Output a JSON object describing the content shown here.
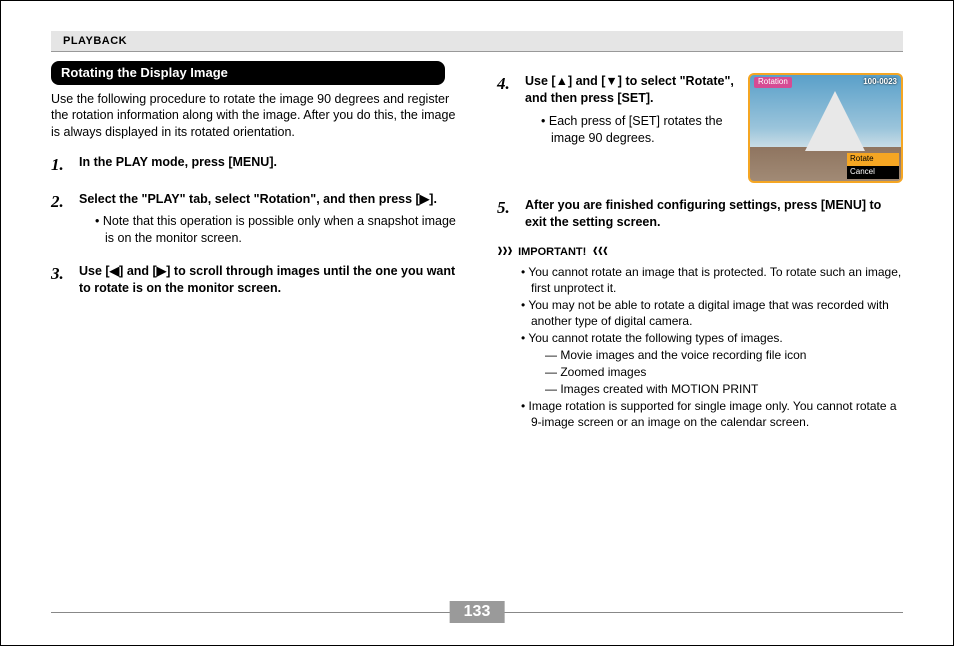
{
  "header": {
    "section": "PLAYBACK"
  },
  "title": "Rotating the Display Image",
  "intro": "Use the following procedure to rotate the image 90 degrees and register the rotation information along with the image. After you do this, the image is always displayed in its rotated orientation.",
  "steps": [
    {
      "num": "1.",
      "title": "In the PLAY mode, press [MENU].",
      "sub": []
    },
    {
      "num": "2.",
      "title": "Select the \"PLAY\" tab, select \"Rotation\", and then press [▶].",
      "sub": [
        "Note that this operation is possible only when a snapshot image is on the monitor screen."
      ]
    },
    {
      "num": "3.",
      "title": "Use [◀] and [▶] to scroll through images until the one you want to rotate is on the monitor screen.",
      "sub": []
    },
    {
      "num": "4.",
      "title": "Use [▲] and [▼] to select \"Rotate\", and then press [SET].",
      "sub": [
        "Each press of [SET] rotates the image 90 degrees."
      ]
    },
    {
      "num": "5.",
      "title": "After you are finished configuring settings, press [MENU] to exit the setting screen.",
      "sub": []
    }
  ],
  "screenshot": {
    "title_tag": "Rotation",
    "image_id": "100-0023",
    "menu_selected": "Rotate",
    "menu_unselected": "Cancel"
  },
  "important": {
    "label": "IMPORTANT!",
    "arrows_l": "❱❱❱",
    "arrows_r": "❰❰❰",
    "items": [
      "You cannot rotate an image that is protected. To rotate such an image, first unprotect it.",
      "You may not be able to rotate a digital image that was recorded with another type of digital camera.",
      "You cannot rotate the following types of images.",
      "Image rotation is supported for single image only. You cannot rotate a 9-image screen or an image on the calendar screen."
    ],
    "types_sub": [
      "Movie images and the voice recording file icon",
      "Zoomed images",
      "Images created with MOTION PRINT"
    ]
  },
  "page_number": "133"
}
